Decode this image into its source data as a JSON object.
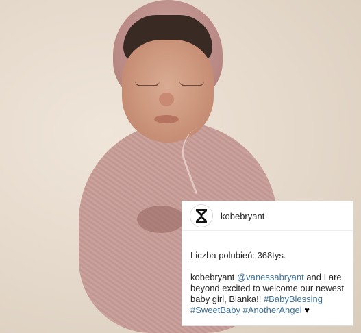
{
  "post": {
    "username": "kobebryant",
    "likes_text": "Liczba polubień: 368tys.",
    "caption": {
      "author": "kobebryant",
      "mention": "@vanessabryant",
      "text_1": " and I are beyond excited to welcome our newest baby girl, Bianka!! ",
      "hashtag_1": "#BabyBlessing",
      "hashtag_2": "#SweetBaby",
      "hashtag_3": "#AnotherAngel",
      "emoji": "♥"
    },
    "avatar_icon": "kobe-logo-icon"
  },
  "colors": {
    "link": "#3f729b",
    "text": "#262626",
    "border": "#dbdbdb"
  }
}
